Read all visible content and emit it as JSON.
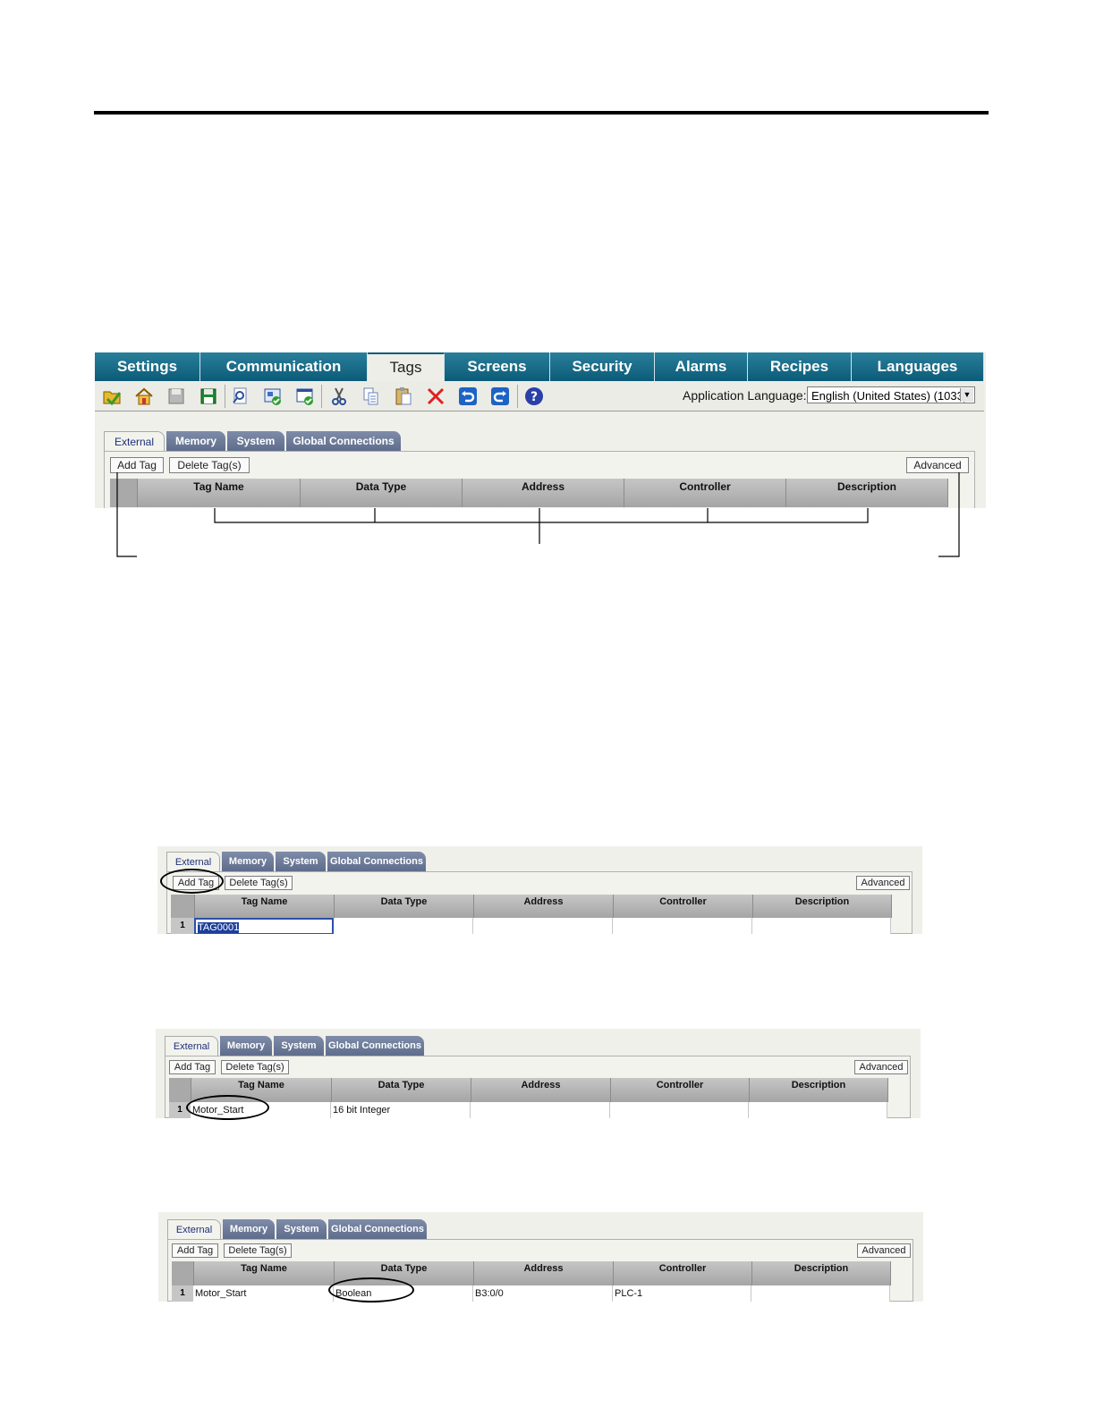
{
  "app": {
    "main_tabs": [
      "Settings",
      "Communication",
      "Tags",
      "Screens",
      "Security",
      "Alarms",
      "Recipes",
      "Languages"
    ],
    "active_main_tab": "Tags",
    "toolbar_icons": [
      "open-folder-icon",
      "home-icon",
      "save-icon",
      "save-as-icon",
      "find-icon",
      "validate-icon",
      "download-icon",
      "cut-icon",
      "copy-icon",
      "paste-icon",
      "delete-icon",
      "undo-icon",
      "redo-icon",
      "help-icon"
    ],
    "language_label": "Application Language:",
    "language_value": "English (United States) (1033)"
  },
  "editor": {
    "subtabs": [
      "External",
      "Memory",
      "System",
      "Global Connections"
    ],
    "active_subtab": "External",
    "add_tag": "Add Tag",
    "delete_tags": "Delete Tag(s)",
    "advanced": "Advanced",
    "columns": [
      "Tag Name",
      "Data Type",
      "Address",
      "Controller",
      "Description"
    ]
  },
  "step1": {
    "row": {
      "num": "1",
      "tag_name": "TAG0001",
      "data_type": "",
      "address": "",
      "controller": "",
      "description": ""
    }
  },
  "step2": {
    "row": {
      "num": "1",
      "tag_name": "Motor_Start",
      "data_type": "16 bit Integer",
      "address": "",
      "controller": "",
      "description": ""
    }
  },
  "step3": {
    "row": {
      "num": "1",
      "tag_name": "Motor_Start",
      "data_type": "Boolean",
      "address": "B3:0/0",
      "controller": "PLC-1",
      "description": ""
    }
  },
  "colors": {
    "tab_blue": "#0b5b78",
    "subtab_slate": "#5f6d8c",
    "active_subtab_text": "#1c2f78"
  }
}
